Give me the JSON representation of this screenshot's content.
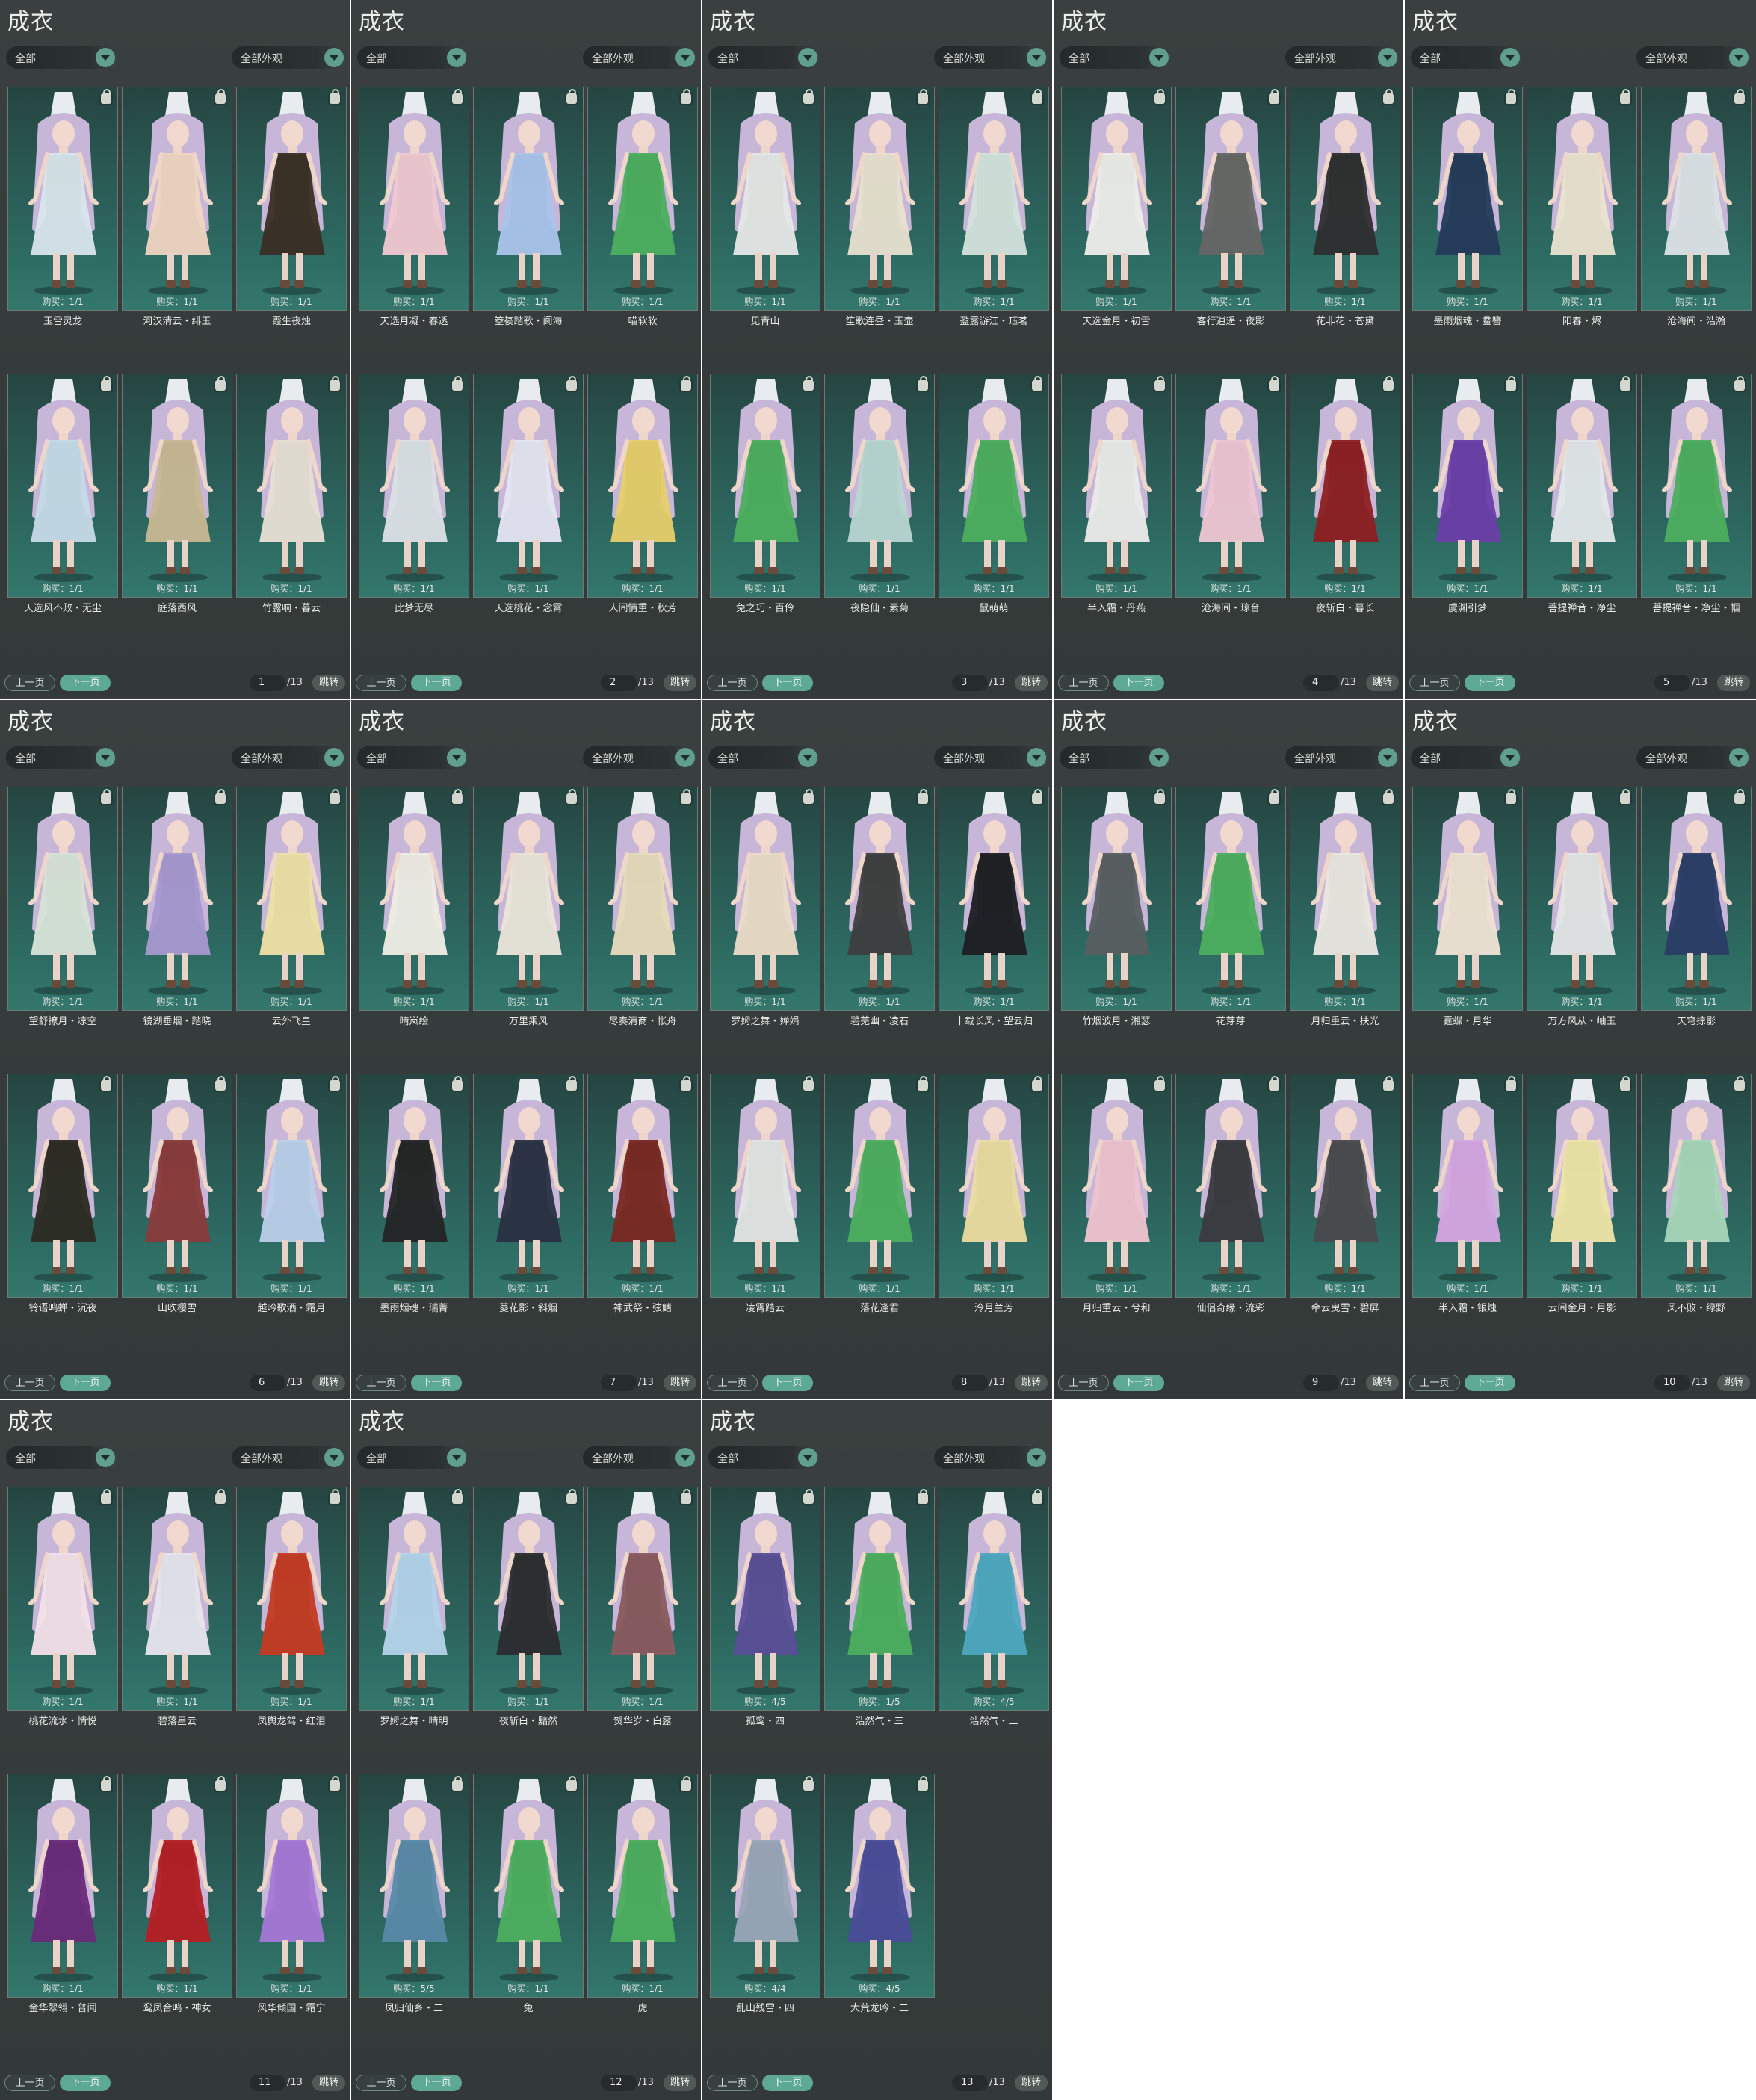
{
  "panels": [
    {
      "title": "成衣",
      "filter1": "全部",
      "filter2": "全部外观",
      "prev": "上一页",
      "next": "下一页",
      "page": "1",
      "total": "/13",
      "jump": "跳转",
      "items": [
        {
          "name": "玉雪灵龙",
          "buy": "购买：1/1",
          "color": "#d9e6ec"
        },
        {
          "name": "河汉清云・绯玉",
          "buy": "购买：1/1",
          "color": "#f0d6c2"
        },
        {
          "name": "霞生夜烛",
          "buy": "购买：1/1",
          "color": "#3a2e24"
        },
        {
          "name": "天选风不败・无尘",
          "buy": "购买：1/1",
          "color": "#c6dbe8"
        },
        {
          "name": "庭落西风",
          "buy": "购买：1/1",
          "color": "#c9b894"
        },
        {
          "name": "竹露响・暮云",
          "buy": "购买：1/1",
          "color": "#e8e0d6"
        }
      ]
    },
    {
      "title": "成衣",
      "filter1": "全部",
      "filter2": "全部外观",
      "prev": "上一页",
      "next": "下一页",
      "page": "2",
      "total": "/13",
      "jump": "跳转",
      "items": [
        {
          "name": "天选月凝・春透",
          "buy": "购买：1/1",
          "color": "#f1c9d2"
        },
        {
          "name": "箜篌踏歌・阆海",
          "buy": "购买：1/1",
          "color": "#aac4ea"
        },
        {
          "name": "喵软软",
          "buy": "购买：1/1",
          "color": "#4cae5d"
        },
        {
          "name": "此梦无尽",
          "buy": "购买：1/1",
          "color": "#dce2e6"
        },
        {
          "name": "天选桃花・念霄",
          "buy": "购买：1/1",
          "color": "#e6e6f2"
        },
        {
          "name": "人间情重・秋芳",
          "buy": "购买：1/1",
          "color": "#e8cf6a"
        }
      ]
    },
    {
      "title": "成衣",
      "filter1": "全部",
      "filter2": "全部外观",
      "prev": "上一页",
      "next": "下一页",
      "page": "3",
      "total": "/13",
      "jump": "跳转",
      "items": [
        {
          "name": "见青山",
          "buy": "购买：1/1",
          "color": "#e6e8e6"
        },
        {
          "name": "笙歌连昼・玉壶",
          "buy": "购买：1/1",
          "color": "#e9e1d0"
        },
        {
          "name": "盈露游江・珏茗",
          "buy": "购买：1/1",
          "color": "#d4e3dc"
        },
        {
          "name": "兔之巧・百伶",
          "buy": "购买：1/1",
          "color": "#4cae5d"
        },
        {
          "name": "夜隐仙・素菊",
          "buy": "购买：1/1",
          "color": "#b8d6d2"
        },
        {
          "name": "鼠萌萌",
          "buy": "购买：1/1",
          "color": "#4cae5d"
        }
      ]
    },
    {
      "title": "成衣",
      "filter1": "全部",
      "filter2": "全部外观",
      "prev": "上一页",
      "next": "下一页",
      "page": "4",
      "total": "/13",
      "jump": "跳转",
      "items": [
        {
          "name": "天选金月・初雪",
          "buy": "购买：1/1",
          "color": "#eeeeea"
        },
        {
          "name": "客行逍遥・夜影",
          "buy": "购买：1/1",
          "color": "#666664"
        },
        {
          "name": "花非花・苍黛",
          "buy": "购买：1/1",
          "color": "#2e2e2e"
        },
        {
          "name": "半入霜・丹燕",
          "buy": "购买：1/1",
          "color": "#ececea"
        },
        {
          "name": "沧海间・琼台",
          "buy": "购买：1/1",
          "color": "#efc5d3"
        },
        {
          "name": "夜斩白・暮长",
          "buy": "购买：1/1",
          "color": "#8e1f22"
        }
      ]
    },
    {
      "title": "成衣",
      "filter1": "全部",
      "filter2": "全部外观",
      "prev": "上一页",
      "next": "下一页",
      "page": "5",
      "total": "/13",
      "jump": "跳转",
      "items": [
        {
          "name": "墨雨烟魂・鲞簪",
          "buy": "购买：1/1",
          "color": "#243a58"
        },
        {
          "name": "阳春・烬",
          "buy": "购买：1/1",
          "color": "#ece4d0"
        },
        {
          "name": "沧海间・浩瀚",
          "buy": "购买：1/1",
          "color": "#dde3e6"
        },
        {
          "name": "虞渊引梦",
          "buy": "购买：1/1",
          "color": "#6b3ea8"
        },
        {
          "name": "菩提禅音・净尘",
          "buy": "购买：1/1",
          "color": "#e4e8ea"
        },
        {
          "name": "菩提禅音・净尘・帼",
          "buy": "购买：1/1",
          "color": "#4cae5d"
        }
      ]
    },
    {
      "title": "成衣",
      "filter1": "全部",
      "filter2": "全部外观",
      "prev": "上一页",
      "next": "下一页",
      "page": "6",
      "total": "/13",
      "jump": "跳转",
      "items": [
        {
          "name": "望舒撩月・凉空",
          "buy": "购买：1/1",
          "color": "#d9e4d8"
        },
        {
          "name": "镜湖垂烟・踏晓",
          "buy": "购买：1/1",
          "color": "#a898d0"
        },
        {
          "name": "云外飞皇",
          "buy": "购买：1/1",
          "color": "#efe2a6"
        },
        {
          "name": "铃语鸣蝉・沉夜",
          "buy": "购买：1/1",
          "color": "#2c2a22"
        },
        {
          "name": "山吹樱雪",
          "buy": "购买：1/1",
          "color": "#8a3a3a"
        },
        {
          "name": "越吟歌洒・霜月",
          "buy": "购买：1/1",
          "color": "#bcd0ea"
        }
      ]
    },
    {
      "title": "成衣",
      "filter1": "全部",
      "filter2": "全部外观",
      "prev": "上一页",
      "next": "下一页",
      "page": "7",
      "total": "/13",
      "jump": "跳转",
      "items": [
        {
          "name": "晴岚绘",
          "buy": "购买：1/1",
          "color": "#f0eee6"
        },
        {
          "name": "万里乘风",
          "buy": "购买：1/1",
          "color": "#ece6da"
        },
        {
          "name": "尽奏清商・怅舟",
          "buy": "购买：1/1",
          "color": "#e8dcbc"
        },
        {
          "name": "墨雨烟魂・瑞菁",
          "buy": "购买：1/1",
          "color": "#242424"
        },
        {
          "name": "菱花影・斜烟",
          "buy": "购买：1/1",
          "color": "#2a3042"
        },
        {
          "name": "神武祭・弦鳍",
          "buy": "购买：1/1",
          "color": "#7a2822"
        }
      ]
    },
    {
      "title": "成衣",
      "filter1": "全部",
      "filter2": "全部外观",
      "prev": "上一页",
      "next": "下一页",
      "page": "8",
      "total": "/13",
      "jump": "跳转",
      "items": [
        {
          "name": "罗姆之舞・婵娟",
          "buy": "购买：1/1",
          "color": "#ecdcc8"
        },
        {
          "name": "碧芜幽・凌石",
          "buy": "购买：1/1",
          "color": "#3e3e3e"
        },
        {
          "name": "十载长风・望云归",
          "buy": "购买：1/1",
          "color": "#1e1e22"
        },
        {
          "name": "凌霄踏云",
          "buy": "购买：1/1",
          "color": "#e4e6e4"
        },
        {
          "name": "落花逢君",
          "buy": "购买：1/1",
          "color": "#4cae5d"
        },
        {
          "name": "泠月兰芳",
          "buy": "购买：1/1",
          "color": "#ecdca0"
        }
      ]
    },
    {
      "title": "成衣",
      "filter1": "全部",
      "filter2": "全部外观",
      "prev": "上一页",
      "next": "下一页",
      "page": "9",
      "total": "/13",
      "jump": "跳转",
      "items": [
        {
          "name": "竹烟波月・湘瑟",
          "buy": "购买：1/1",
          "color": "#5a5e60"
        },
        {
          "name": "花芽芽",
          "buy": "购买：1/1",
          "color": "#4cae5d"
        },
        {
          "name": "月归重云・扶光",
          "buy": "购买：1/1",
          "color": "#ece8e2"
        },
        {
          "name": "月归重云・兮和",
          "buy": "购买：1/1",
          "color": "#f0c4d0"
        },
        {
          "name": "仙侣奇缘・流彩",
          "buy": "购买：1/1",
          "color": "#3a3a3e"
        },
        {
          "name": "牵云曳雪・碧屏",
          "buy": "购买：1/1",
          "color": "#4a4a4c"
        }
      ]
    },
    {
      "title": "成衣",
      "filter1": "全部",
      "filter2": "全部外观",
      "prev": "上一页",
      "next": "下一页",
      "page": "10",
      "total": "/13",
      "jump": "跳转",
      "items": [
        {
          "name": "霆蝶・月华",
          "buy": "购买：1/1",
          "color": "#f0e4d4"
        },
        {
          "name": "万方风从・岫玉",
          "buy": "购买：1/1",
          "color": "#e6e6e6"
        },
        {
          "name": "天穹掠影",
          "buy": "购买：1/1",
          "color": "#2a3c66"
        },
        {
          "name": "半入霜・银烛",
          "buy": "购买：1/1",
          "color": "#d6a6e2"
        },
        {
          "name": "云间金月・月影",
          "buy": "购买：1/1",
          "color": "#efe6a8"
        },
        {
          "name": "风不败・绿野",
          "buy": "购买：1/1",
          "color": "#a8d6b8"
        }
      ]
    },
    {
      "title": "成衣",
      "filter1": "全部",
      "filter2": "全部外观",
      "prev": "上一页",
      "next": "下一页",
      "page": "11",
      "total": "/13",
      "jump": "跳转",
      "items": [
        {
          "name": "桃花流水・情悦",
          "buy": "购买：1/1",
          "color": "#f4e2ea"
        },
        {
          "name": "碧落星云",
          "buy": "购买：1/1",
          "color": "#e8e6ee"
        },
        {
          "name": "凤舆龙驾・红泪",
          "buy": "购买：1/1",
          "color": "#c53a22"
        },
        {
          "name": "金华翠翎・普闻",
          "buy": "购买：1/1",
          "color": "#6a2a7a"
        },
        {
          "name": "鸾凤合鸣・神女",
          "buy": "购买：1/1",
          "color": "#b51e24"
        },
        {
          "name": "风华倾国・霜宁",
          "buy": "购买：1/1",
          "color": "#a778d6"
        }
      ]
    },
    {
      "title": "成衣",
      "filter1": "全部",
      "filter2": "全部外观",
      "prev": "上一页",
      "next": "下一页",
      "page": "12",
      "total": "/13",
      "jump": "跳转",
      "items": [
        {
          "name": "罗姆之舞・晴明",
          "buy": "购买：1/1",
          "color": "#b4d4ea"
        },
        {
          "name": "夜斩白・黯然",
          "buy": "购买：1/1",
          "color": "#2c2c2e"
        },
        {
          "name": "贺华岁・白露",
          "buy": "购买：1/1",
          "color": "#8a5a5e"
        },
        {
          "name": "凤归仙乡・二",
          "buy": "购买：5/5",
          "color": "#5a8aa6"
        },
        {
          "name": "兔",
          "buy": "购买：1/1",
          "color": "#4cae5d"
        },
        {
          "name": "虎",
          "buy": "购买：1/1",
          "color": "#4cae5d"
        }
      ]
    },
    {
      "title": "成衣",
      "filter1": "全部",
      "filter2": "全部外观",
      "prev": "上一页",
      "next": "下一页",
      "page": "13",
      "total": "/13",
      "jump": "跳转",
      "items": [
        {
          "name": "孤鸾・四",
          "buy": "购买：4/5",
          "color": "#5a4e96"
        },
        {
          "name": "浩然气・三",
          "buy": "购买：1/5",
          "color": "#4cae5d"
        },
        {
          "name": "浩然气・二",
          "buy": "购买：4/5",
          "color": "#4ea8c0"
        },
        {
          "name": "乱山残雪・四",
          "buy": "购买：4/4",
          "color": "#9aa6b8"
        },
        {
          "name": "大荒龙吟・二",
          "buy": "购买：4/5",
          "color": "#4a4c98"
        }
      ]
    }
  ]
}
